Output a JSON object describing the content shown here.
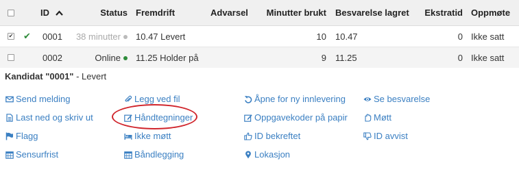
{
  "table": {
    "columns": {
      "id": "ID",
      "status": "Status",
      "fremdrift": "Fremdrift",
      "advarsel": "Advarsel",
      "minutter": "Minutter brukt",
      "besvarelse": "Besvarelse lagret",
      "ekstratid": "Ekstratid",
      "oppmote": "Oppmøte"
    },
    "rows": [
      {
        "checked": true,
        "id": "0001",
        "status": "38 minutter",
        "fremdrift": "10.47 Levert",
        "minutter": "10",
        "besvarelse": "10.47",
        "ekstratid": "0",
        "oppmote": "Ikke satt"
      },
      {
        "checked": false,
        "id": "0002",
        "status": "Online",
        "fremdrift": "11.25 Holder på",
        "minutter": "9",
        "besvarelse": "11.25",
        "ekstratid": "0",
        "oppmote": "Ikke satt"
      }
    ]
  },
  "panel": {
    "title_bold": "Kandidat \"0001\"",
    "title_rest": " - Levert",
    "actions": {
      "send_melding": "Send melding",
      "legg_ved_fil": "Legg ved fil",
      "apne_ny_innlevering": "Åpne for ny innlevering",
      "se_besvarelse": "Se besvarelse",
      "last_ned": "Last ned og skriv ut",
      "handtegninger": "Håndtegninger",
      "oppgavekoder": "Oppgavekoder på papir",
      "mott": "Møtt",
      "flagg": "Flagg",
      "ikke_mott": "Ikke møtt",
      "id_bekreftet": "ID bekreftet",
      "id_avvist": "ID avvist",
      "sensurfrist": "Sensurfrist",
      "bandlegging": "Båndlegging",
      "lokasjon": "Lokasjon"
    }
  },
  "colors": {
    "link": "#3a7fc2",
    "online": "#2e8b3a",
    "highlight": "#d0252c"
  }
}
